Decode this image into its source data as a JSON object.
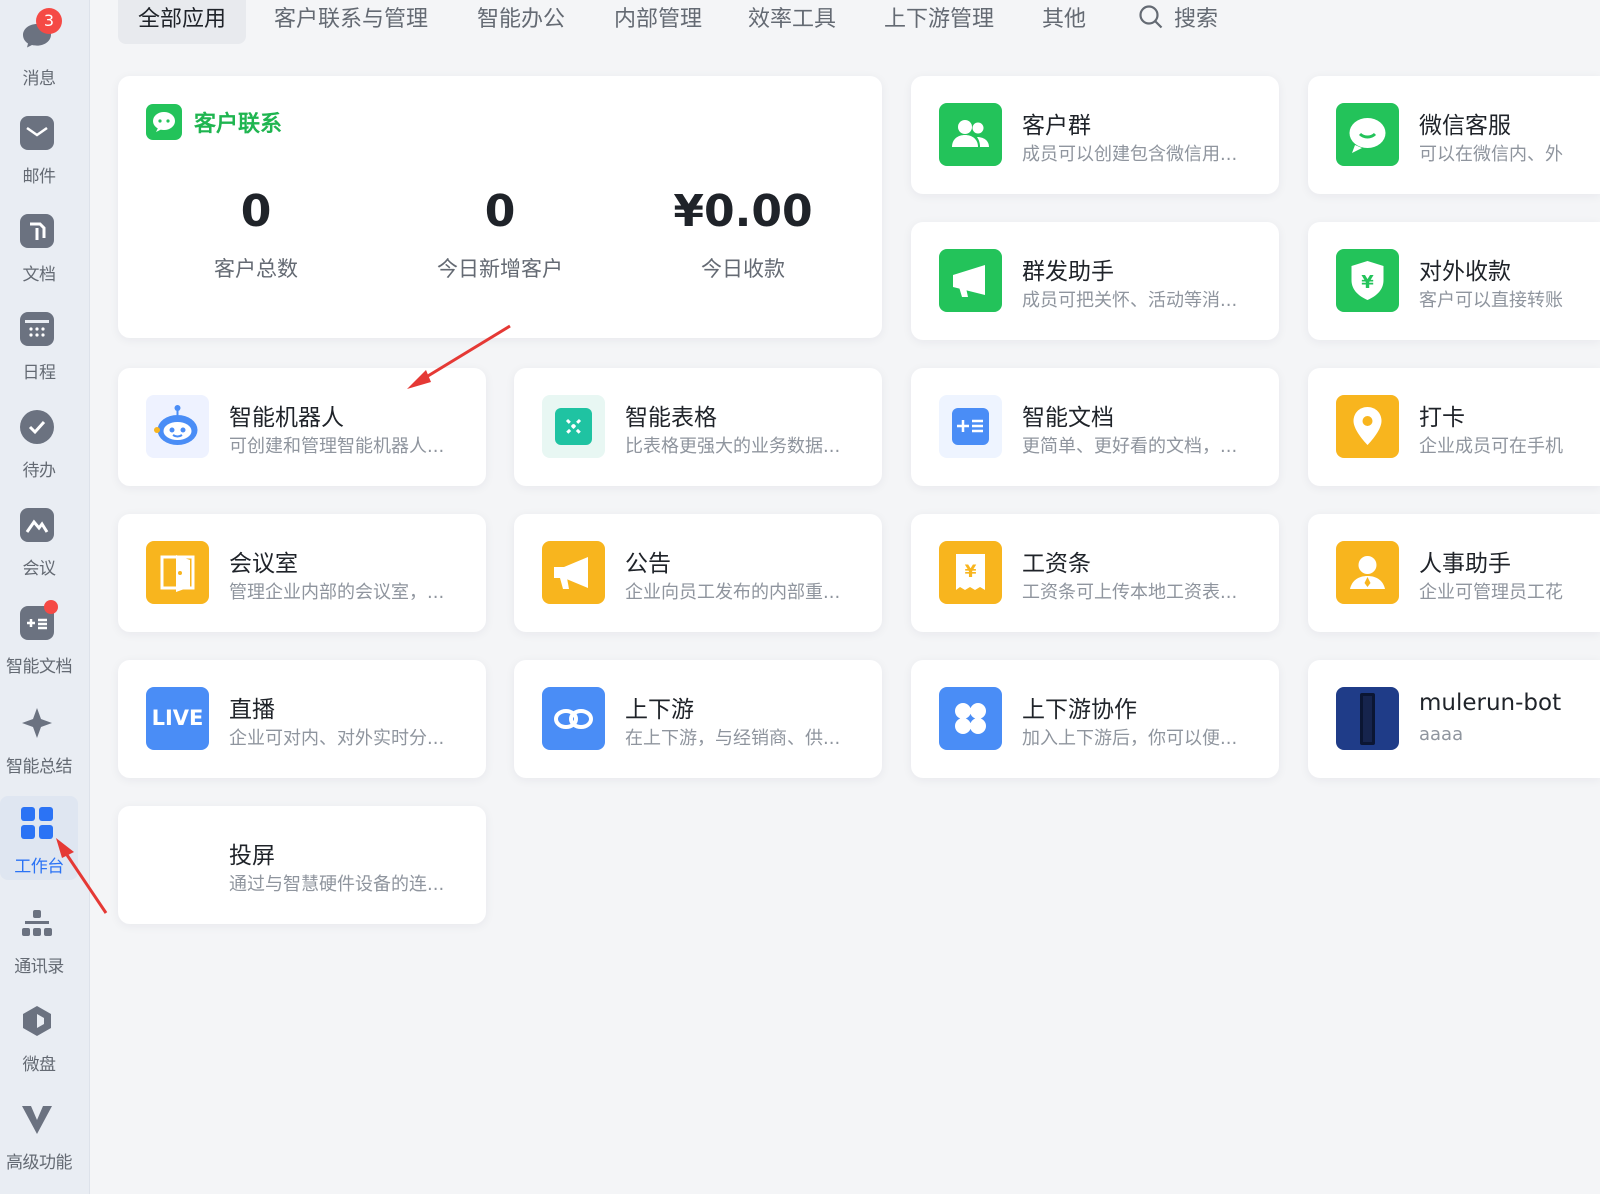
{
  "sidebar": {
    "items": [
      {
        "label": "消息",
        "icon": "chat-bubble-icon",
        "badge": "3"
      },
      {
        "label": "邮件",
        "icon": "mail-icon"
      },
      {
        "label": "文档",
        "icon": "document-icon"
      },
      {
        "label": "日程",
        "icon": "calendar-icon"
      },
      {
        "label": "待办",
        "icon": "check-circle-icon"
      },
      {
        "label": "会议",
        "icon": "meeting-icon"
      },
      {
        "label": "智能文档",
        "icon": "smart-doc-icon",
        "dot": true
      },
      {
        "label": "智能总结",
        "icon": "sparkle-icon"
      },
      {
        "label": "工作台",
        "icon": "grid-icon",
        "active": true
      },
      {
        "label": "通讯录",
        "icon": "org-chart-icon"
      },
      {
        "label": "微盘",
        "icon": "cloud-drive-icon"
      },
      {
        "label": "高级功能",
        "icon": "v-logo-icon"
      }
    ]
  },
  "tabs": [
    "全部应用",
    "客户联系与管理",
    "智能办公",
    "内部管理",
    "效率工具",
    "上下游管理",
    "其他"
  ],
  "search_label": "搜索",
  "customer_contact": {
    "title": "客户联系",
    "stats": [
      {
        "value": "0",
        "label": "客户总数"
      },
      {
        "value": "0",
        "label": "今日新增客户"
      },
      {
        "value": "¥0.00",
        "label": "今日收款"
      }
    ]
  },
  "apps": {
    "customer_group": {
      "title": "客户群",
      "desc": "成员可以创建包含微信用..."
    },
    "wechat_service": {
      "title": "微信客服",
      "desc": "可以在微信内、外"
    },
    "mass_message": {
      "title": "群发助手",
      "desc": "成员可把关怀、活动等消..."
    },
    "external_payment": {
      "title": "对外收款",
      "desc": "客户可以直接转账"
    },
    "smart_robot": {
      "title": "智能机器人",
      "desc": "可创建和管理智能机器人..."
    },
    "smart_sheet": {
      "title": "智能表格",
      "desc": "比表格更强大的业务数据..."
    },
    "smart_doc": {
      "title": "智能文档",
      "desc": "更简单、更好看的文档，..."
    },
    "check_in": {
      "title": "打卡",
      "desc": "企业成员可在手机"
    },
    "meeting_room": {
      "title": "会议室",
      "desc": "管理企业内部的会议室，..."
    },
    "announcement": {
      "title": "公告",
      "desc": "企业向员工发布的内部重..."
    },
    "payslip": {
      "title": "工资条",
      "desc": "工资条可上传本地工资表..."
    },
    "hr_assistant": {
      "title": "人事助手",
      "desc": "企业可管理员工花"
    },
    "live": {
      "title": "直播",
      "desc": "企业可对内、对外实时分...",
      "icon_text": "LIVE"
    },
    "supply_chain": {
      "title": "上下游",
      "desc": "在上下游，与经销商、供..."
    },
    "supply_collab": {
      "title": "上下游协作",
      "desc": "加入上下游后，你可以便..."
    },
    "mulerun_bot": {
      "title": "mulerun-bot",
      "desc": "aaaa"
    },
    "screen_cast": {
      "title": "投屏",
      "desc": "通过与智慧硬件设备的连..."
    }
  },
  "colors": {
    "green": "#23c35a",
    "orange": "#f8b51e",
    "blue": "#4a8df6",
    "active_blue": "#2b73f5",
    "annotation_red": "#e53935"
  }
}
